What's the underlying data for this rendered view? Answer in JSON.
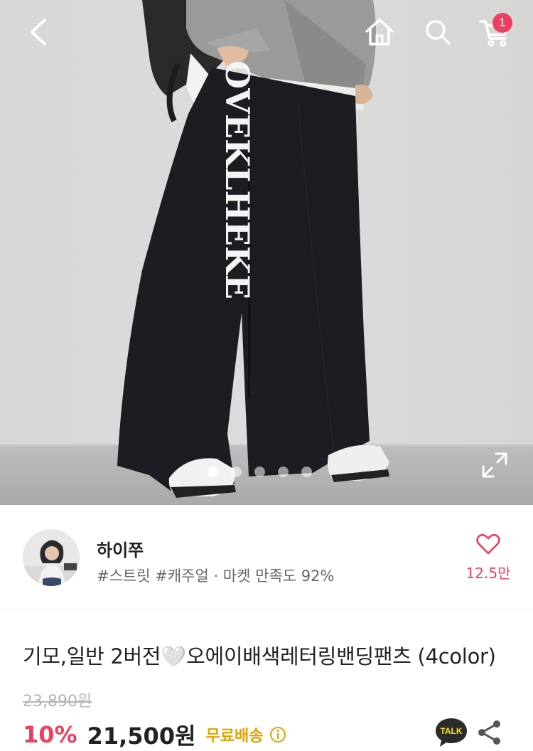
{
  "header": {
    "back_icon": "chevron-left-icon",
    "home_icon": "home-icon",
    "search_icon": "search-icon",
    "cart_icon": "cart-icon",
    "cart_count": "1"
  },
  "gallery": {
    "image_count": 5,
    "active_index": 0,
    "garment_print": "OVEKLHEKE"
  },
  "seller": {
    "name": "하이쭈",
    "tags": "#스트릿 #캐주얼 · 마켓 만족도 92%",
    "favorite_count": "12.5만"
  },
  "product": {
    "title": "기모,일반 2버전🤍오에이배색레터링밴딩팬츠 (4color)",
    "original_price": "23,890원",
    "discount": "10%",
    "price": "21,500원",
    "shipping": "무료배송"
  },
  "actions": {
    "talk_label": "TALK"
  },
  "colors": {
    "accent": "#ef3f5e",
    "shipping": "#e3a200",
    "talk_bg": "#fee500"
  }
}
